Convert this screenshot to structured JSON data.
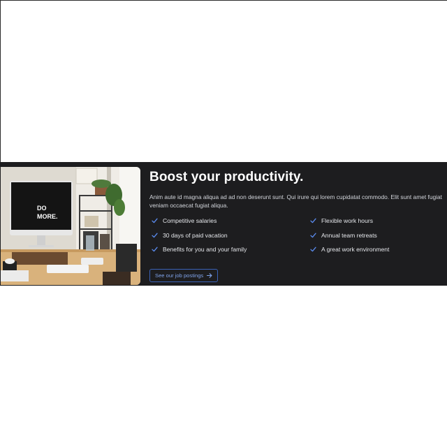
{
  "banner": {
    "heading": "Boost your productivity.",
    "description": "Anim aute id magna aliqua ad ad non deserunt sunt. Qui irure qui lorem cupidatat commodo. Elit sunt amet fugiat veniam occaecat fugiat aliqua.",
    "image": {
      "monitor_text_line1": "DO",
      "monitor_text_line2": "MORE."
    },
    "perks": [
      {
        "label": "Competitive salaries",
        "icon": "check-icon"
      },
      {
        "label": "30 days of paid vacation",
        "icon": "check-icon"
      },
      {
        "label": "Benefits for you and your family",
        "icon": "check-icon"
      },
      {
        "label": "Flexible work hours",
        "icon": "check-icon"
      },
      {
        "label": "Annual team retreats",
        "icon": "check-icon"
      },
      {
        "label": "A great work environment",
        "icon": "check-icon"
      }
    ],
    "cta_label": "See our job postings",
    "cta_icon": "arrow-right-icon"
  },
  "colors": {
    "background": "#1d1d1f",
    "heading": "#ffffff",
    "accent": "#3b63b8",
    "check": "#5b8cf0"
  }
}
